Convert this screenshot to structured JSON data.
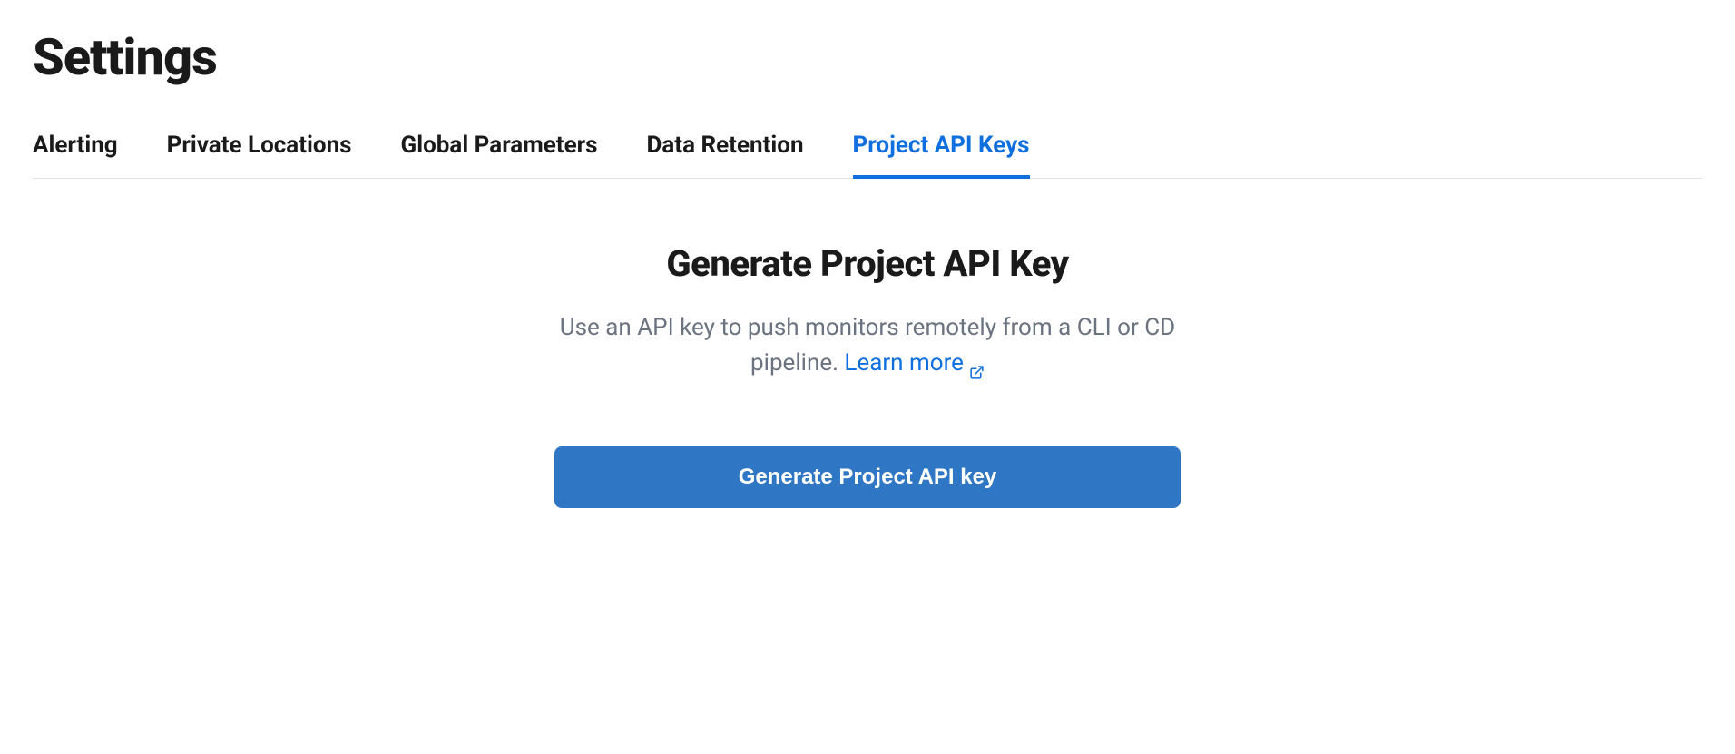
{
  "pageTitle": "Settings",
  "tabs": [
    {
      "label": "Alerting",
      "active": false
    },
    {
      "label": "Private Locations",
      "active": false
    },
    {
      "label": "Global Parameters",
      "active": false
    },
    {
      "label": "Data Retention",
      "active": false
    },
    {
      "label": "Project API Keys",
      "active": true
    }
  ],
  "content": {
    "heading": "Generate Project API Key",
    "descriptionPrefix": "Use an API key to push monitors remotely from a CLI or CD pipeline. ",
    "learnMoreLabel": "Learn more",
    "buttonLabel": "Generate Project API key"
  }
}
